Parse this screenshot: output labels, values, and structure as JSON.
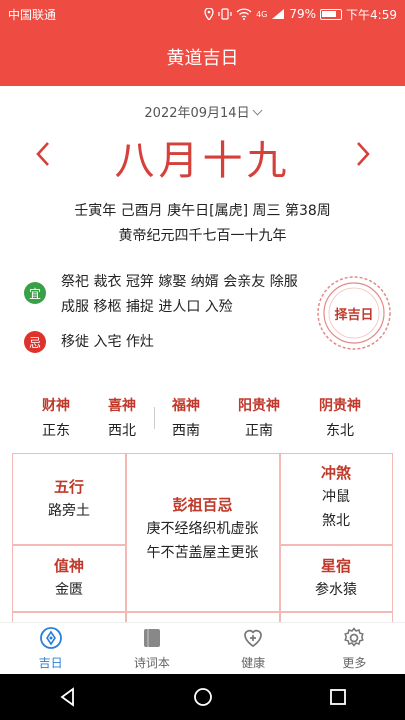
{
  "status_bar": {
    "carrier": "中国联通",
    "network": "4G",
    "battery": "79%",
    "time": "下午4:59"
  },
  "app": {
    "title": "黄道吉日"
  },
  "date_selector": {
    "label": "2022年09月14日"
  },
  "lunar_date": "八月十九",
  "ganzhi_line": "壬寅年 己酉月 庚午日[属虎] 周三 第38周",
  "era_line": "黄帝纪元四千七百一十九年",
  "yi": {
    "badge": "宜",
    "items": "祭祀 裁衣 冠笄 嫁娶 纳婿 会亲友 除服 成服 移柩 捕捉 进人口 入殓"
  },
  "ji": {
    "badge": "忌",
    "items": "移徙 入宅 作灶"
  },
  "seal": {
    "label": "择吉日"
  },
  "gods": [
    {
      "name": "财神",
      "dir": "正东"
    },
    {
      "name": "喜神",
      "dir": "西北"
    },
    {
      "name": "福神",
      "dir": "西南"
    },
    {
      "name": "阳贵神",
      "dir": "正南"
    },
    {
      "name": "阴贵神",
      "dir": "东北"
    }
  ],
  "grid": {
    "wuxing": {
      "title": "五行",
      "value": "路旁土"
    },
    "zhishen": {
      "title": "值神",
      "value": "金匮"
    },
    "pengzu": {
      "title": "彭祖百忌",
      "line1": "庚不经络织机虚张",
      "line2": "午不苫盖屋主更张"
    },
    "chongsha": {
      "title": "冲煞",
      "line1": "冲鼠",
      "line2": "煞北"
    },
    "xingxiu": {
      "title": "星宿",
      "value": "参水猿"
    }
  },
  "tabs": [
    {
      "label": "吉日",
      "icon": "compass-icon",
      "active": true
    },
    {
      "label": "诗词本",
      "icon": "book-icon",
      "active": false
    },
    {
      "label": "健康",
      "icon": "heart-plus-icon",
      "active": false
    },
    {
      "label": "更多",
      "icon": "gear-icon",
      "active": false
    }
  ],
  "colors": {
    "primary": "#ee4b43",
    "lunar": "#d4403a",
    "yi": "#3aa048",
    "ji": "#e0322d",
    "tab_active": "#2a7fd8"
  }
}
